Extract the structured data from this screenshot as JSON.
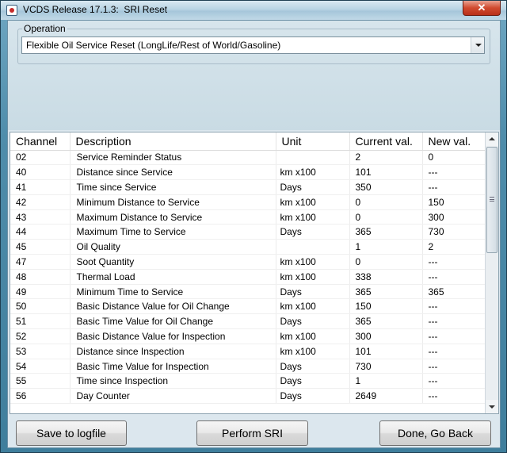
{
  "window": {
    "title": "VCDS Release 17.1.3:  SRI Reset",
    "close_symbol": "✕"
  },
  "operation": {
    "group_label": "Operation",
    "selected": "Flexible Oil Service Reset (LongLife/Rest of World/Gasoline)"
  },
  "table": {
    "headers": [
      "Channel",
      "Description",
      "Unit",
      "Current val.",
      "New val."
    ],
    "rows": [
      [
        "02",
        "Service Reminder Status",
        "",
        "2",
        "0"
      ],
      [
        "40",
        "Distance since Service",
        "km x100",
        "101",
        "---"
      ],
      [
        "41",
        "Time since Service",
        "Days",
        "350",
        "---"
      ],
      [
        "42",
        "Minimum Distance to Service",
        "km x100",
        "0",
        "150"
      ],
      [
        "43",
        "Maximum Distance to Service",
        "km x100",
        "0",
        "300"
      ],
      [
        "44",
        "Maximum Time to Service",
        "Days",
        "365",
        "730"
      ],
      [
        "45",
        "Oil Quality",
        "",
        "1",
        "2"
      ],
      [
        "47",
        "Soot Quantity",
        "km x100",
        "0",
        "---"
      ],
      [
        "48",
        "Thermal Load",
        "km x100",
        "338",
        "---"
      ],
      [
        "49",
        "Minimum Time to Service",
        "Days",
        "365",
        "365"
      ],
      [
        "50",
        "Basic Distance Value for Oil Change",
        "km x100",
        "150",
        "---"
      ],
      [
        "51",
        "Basic Time Value for Oil Change",
        "Days",
        "365",
        "---"
      ],
      [
        "52",
        "Basic Distance Value for Inspection",
        "km x100",
        "300",
        "---"
      ],
      [
        "53",
        "Distance since Inspection",
        "km x100",
        "101",
        "---"
      ],
      [
        "54",
        "Basic Time Value for Inspection",
        "Days",
        "730",
        "---"
      ],
      [
        "55",
        "Time since Inspection",
        "Days",
        "1",
        "---"
      ],
      [
        "56",
        "Day Counter",
        "Days",
        "2649",
        "---"
      ]
    ]
  },
  "buttons": {
    "save": "Save to logfile",
    "perform": "Perform SRI",
    "done": "Done, Go Back"
  }
}
